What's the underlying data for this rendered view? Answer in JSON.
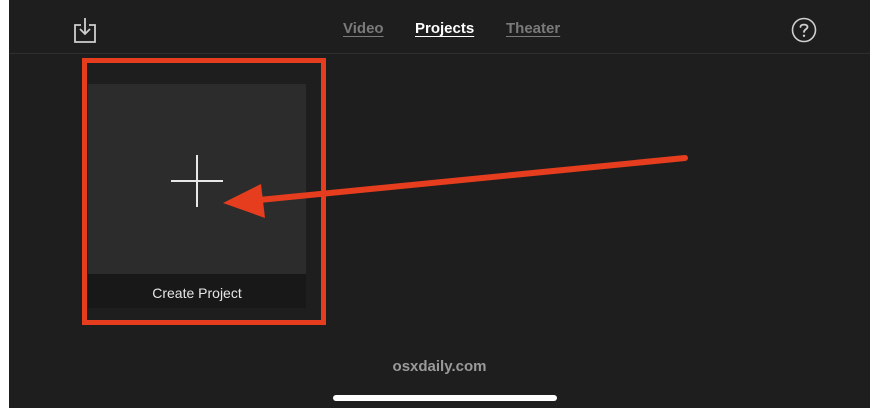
{
  "tabs": [
    {
      "label": "Video",
      "active": false
    },
    {
      "label": "Projects",
      "active": true
    },
    {
      "label": "Theater",
      "active": false
    }
  ],
  "icons": {
    "import": "import-icon",
    "help": "help-icon",
    "plus": "plus-icon"
  },
  "create_project": {
    "label": "Create Project"
  },
  "watermark": "osxdaily.com",
  "colors": {
    "background": "#1e1e1e",
    "tile": "#2c2c2c",
    "active_tab": "#ffffff",
    "inactive_tab": "#7a7a7a",
    "annotation": "#e53d1e"
  }
}
